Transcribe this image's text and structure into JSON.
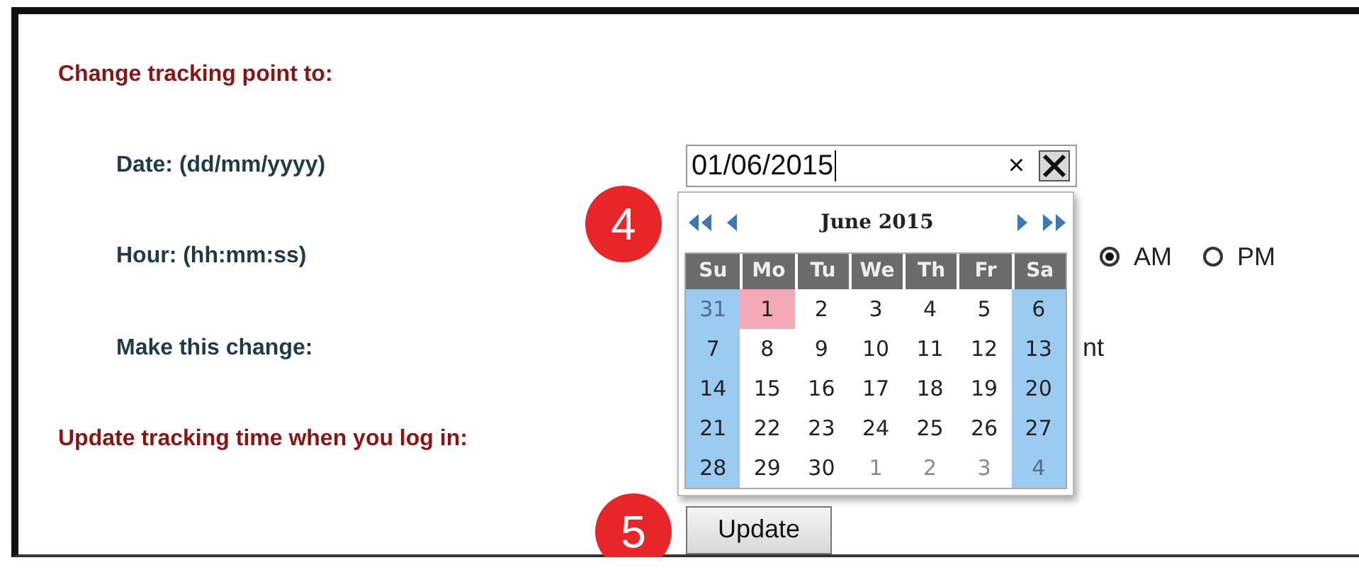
{
  "heading": "Change tracking point to:",
  "date": {
    "label": "Date: (dd/mm/yyyy)",
    "value": "01/06/2015",
    "clear": "×"
  },
  "hour": {
    "label": "Hour: (hh:mm:ss)",
    "period_options": [
      {
        "label": "AM",
        "selected": true
      },
      {
        "label": "PM",
        "selected": false
      }
    ]
  },
  "change": {
    "label": "Make this change:",
    "partial_text": "nt"
  },
  "login_heading": "Update tracking time when you log in:",
  "update_button": "Update",
  "calendar": {
    "title": "June 2015",
    "weekdays": [
      "Su",
      "Mo",
      "Tu",
      "We",
      "Th",
      "Fr",
      "Sa"
    ],
    "days": [
      {
        "day": "31",
        "muted": true,
        "selected": false
      },
      {
        "day": "1",
        "muted": false,
        "selected": true
      },
      {
        "day": "2",
        "muted": false,
        "selected": false
      },
      {
        "day": "3",
        "muted": false,
        "selected": false
      },
      {
        "day": "4",
        "muted": false,
        "selected": false
      },
      {
        "day": "5",
        "muted": false,
        "selected": false
      },
      {
        "day": "6",
        "muted": false,
        "selected": false
      },
      {
        "day": "7",
        "muted": false,
        "selected": false
      },
      {
        "day": "8",
        "muted": false,
        "selected": false
      },
      {
        "day": "9",
        "muted": false,
        "selected": false
      },
      {
        "day": "10",
        "muted": false,
        "selected": false
      },
      {
        "day": "11",
        "muted": false,
        "selected": false
      },
      {
        "day": "12",
        "muted": false,
        "selected": false
      },
      {
        "day": "13",
        "muted": false,
        "selected": false
      },
      {
        "day": "14",
        "muted": false,
        "selected": false
      },
      {
        "day": "15",
        "muted": false,
        "selected": false
      },
      {
        "day": "16",
        "muted": false,
        "selected": false
      },
      {
        "day": "17",
        "muted": false,
        "selected": false
      },
      {
        "day": "18",
        "muted": false,
        "selected": false
      },
      {
        "day": "19",
        "muted": false,
        "selected": false
      },
      {
        "day": "20",
        "muted": false,
        "selected": false
      },
      {
        "day": "21",
        "muted": false,
        "selected": false
      },
      {
        "day": "22",
        "muted": false,
        "selected": false
      },
      {
        "day": "23",
        "muted": false,
        "selected": false
      },
      {
        "day": "24",
        "muted": false,
        "selected": false
      },
      {
        "day": "25",
        "muted": false,
        "selected": false
      },
      {
        "day": "26",
        "muted": false,
        "selected": false
      },
      {
        "day": "27",
        "muted": false,
        "selected": false
      },
      {
        "day": "28",
        "muted": false,
        "selected": false
      },
      {
        "day": "29",
        "muted": false,
        "selected": false
      },
      {
        "day": "30",
        "muted": false,
        "selected": false
      },
      {
        "day": "1",
        "muted": true,
        "selected": false
      },
      {
        "day": "2",
        "muted": true,
        "selected": false
      },
      {
        "day": "3",
        "muted": true,
        "selected": false
      },
      {
        "day": "4",
        "muted": true,
        "selected": false
      }
    ]
  },
  "callouts": [
    "4",
    "5"
  ]
}
